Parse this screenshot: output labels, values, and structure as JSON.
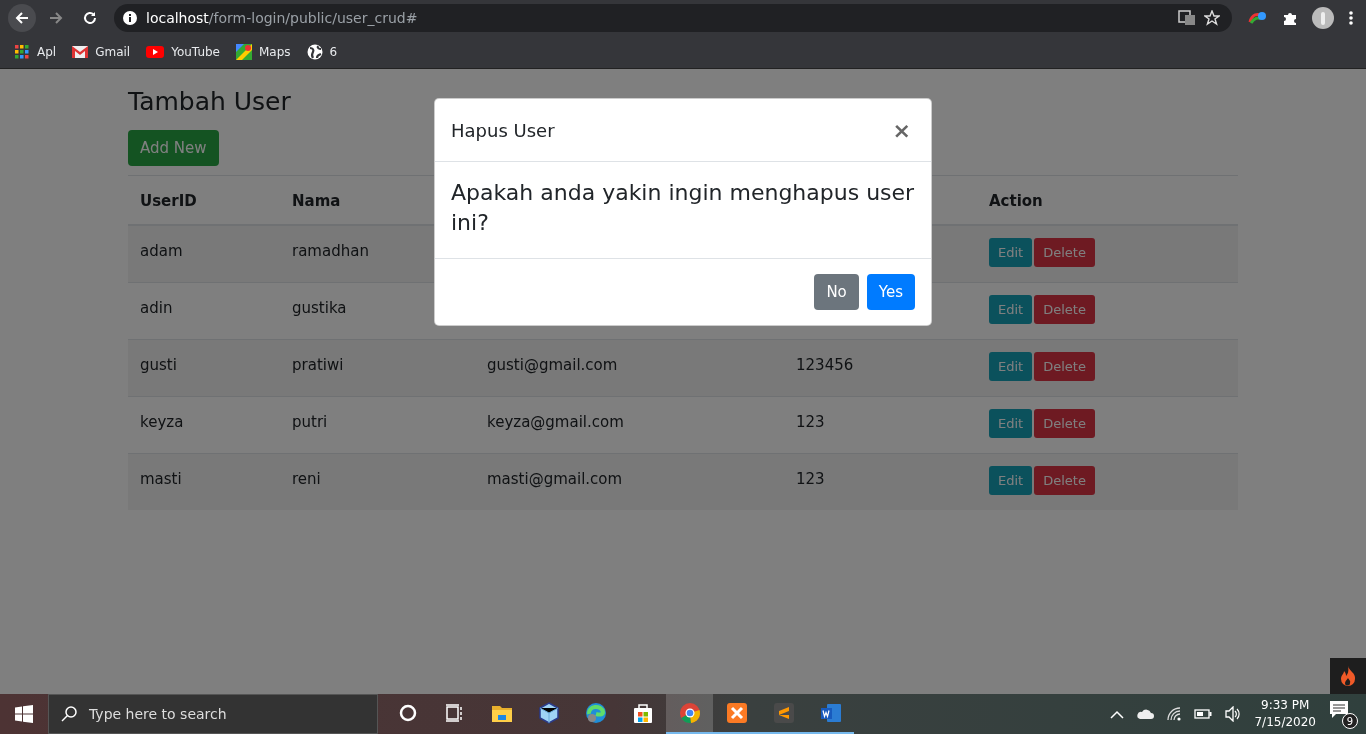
{
  "browser": {
    "url_host": "localhost",
    "url_path": "/form-login/public/user_crud#",
    "bookmarks": [
      {
        "label": "Apl",
        "kind": "apps"
      },
      {
        "label": "Gmail",
        "kind": "gmail"
      },
      {
        "label": "YouTube",
        "kind": "youtube"
      },
      {
        "label": "Maps",
        "kind": "maps"
      },
      {
        "label": "6",
        "kind": "globe"
      }
    ]
  },
  "page": {
    "heading": "Tambah User",
    "add_button": "Add New",
    "table": {
      "columns": [
        "UserID",
        "Nama",
        "Action"
      ],
      "rows": [
        {
          "userid": "adam",
          "nama": "ramadhan",
          "actions": [
            "Edit",
            "Delete"
          ]
        },
        {
          "userid": "adin",
          "nama": "gustika",
          "actions": [
            "Edit",
            "Delete"
          ]
        },
        {
          "userid": "gusti",
          "nama": "pratiwi",
          "email": "gusti@gmail.com",
          "password": "123456",
          "actions": [
            "Edit",
            "Delete"
          ]
        },
        {
          "userid": "keyza",
          "nama": "putri",
          "email": "keyza@gmail.com",
          "password": "123",
          "actions": [
            "Edit",
            "Delete"
          ]
        },
        {
          "userid": "masti",
          "nama": "reni",
          "email": "masti@gmail.com",
          "password": "123",
          "actions": [
            "Edit",
            "Delete"
          ]
        }
      ]
    }
  },
  "modal": {
    "title": "Hapus User",
    "close": "×",
    "message": "Apakah anda yakin ingin menghapus user ini?",
    "buttons": [
      {
        "label": "No",
        "kind": "secondary"
      },
      {
        "label": "Yes",
        "kind": "primary"
      }
    ]
  },
  "taskbar": {
    "search_placeholder": "Type here to search",
    "apps": [
      {
        "kind": "cortana",
        "running": false,
        "selected": false
      },
      {
        "kind": "taskview",
        "running": false,
        "selected": false
      },
      {
        "kind": "folder",
        "running": false,
        "selected": false
      },
      {
        "kind": "cube",
        "running": false,
        "selected": false
      },
      {
        "kind": "edge",
        "running": false,
        "selected": false
      },
      {
        "kind": "store",
        "running": false,
        "selected": false
      },
      {
        "kind": "chrome",
        "running": true,
        "selected": true
      },
      {
        "kind": "xampp",
        "running": true,
        "selected": false
      },
      {
        "kind": "sublime",
        "running": true,
        "selected": false
      },
      {
        "kind": "word",
        "running": true,
        "selected": false
      }
    ],
    "time": "9:33 PM",
    "date": "7/15/2020",
    "notifications": "9"
  }
}
